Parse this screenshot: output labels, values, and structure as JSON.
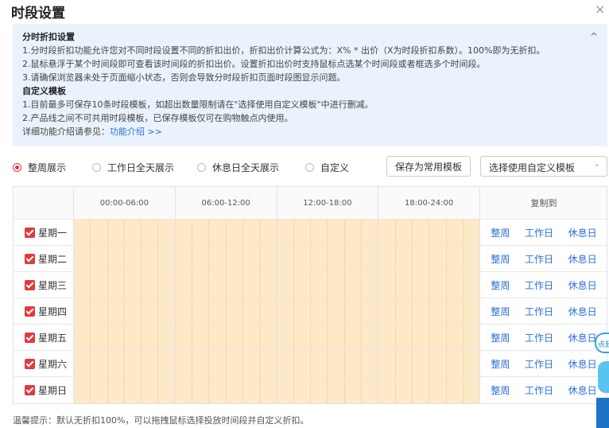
{
  "dialog": {
    "title": "时段设置",
    "close_icon": "×"
  },
  "info": {
    "section1_title": "分时折扣设置",
    "line1": "1.分时段折扣功能允许您对不同时段设置不同的折扣出价，折扣出价计算公式为：X% * 出价（X为时段折扣系数）。100%即为无折扣。",
    "line2": "2.鼠标悬浮于某个时间段即可查看该时间段的折扣出价。设置折扣出价时支持鼠标点选某个时间段或者框选多个时间段。",
    "line3": "3.请确保浏览器未处于页面缩小状态，否则会导致分时段折扣页面时段图显示问题。",
    "section2_title": "自定义模板",
    "line4": "1.目前最多可保存10条时段模板，如超出数量限制请在\"选择使用自定义模板\"中进行删减。",
    "line5": "2.产品线之间不可共用时段模板，已保存模板仅可在购物触点内使用。",
    "more_prefix": "详细功能介绍请参见：",
    "more_link": "功能介绍 >>",
    "collapse_icon": "^"
  },
  "controls": {
    "radios": [
      {
        "label": "整周展示",
        "checked": true
      },
      {
        "label": "工作日全天展示",
        "checked": false
      },
      {
        "label": "休息日全天展示",
        "checked": false
      },
      {
        "label": "自定义",
        "checked": false
      }
    ],
    "save_button": "保存为常用模板",
    "template_select": "选择使用自定义模板",
    "chevron_icon": "⌄"
  },
  "grid": {
    "time_headers": [
      "00:00-06:00",
      "06:00-12:00",
      "12:00-18:00",
      "18:00-24:00"
    ],
    "copy_header": "复制到",
    "days": [
      "星期一",
      "星期二",
      "星期三",
      "星期四",
      "星期五",
      "星期六",
      "星期日"
    ],
    "copy_links": [
      "整周",
      "工作日",
      "休息日"
    ],
    "slot_color": "#fde9c7",
    "accent_color": "#e4393c",
    "link_color": "#2a6fdb"
  },
  "tip": "温馨提示：默认无折扣100%，可以拖拽鼠标选择投放时间段并自定义折扣。",
  "widget": {
    "bubble_text": "点我"
  }
}
